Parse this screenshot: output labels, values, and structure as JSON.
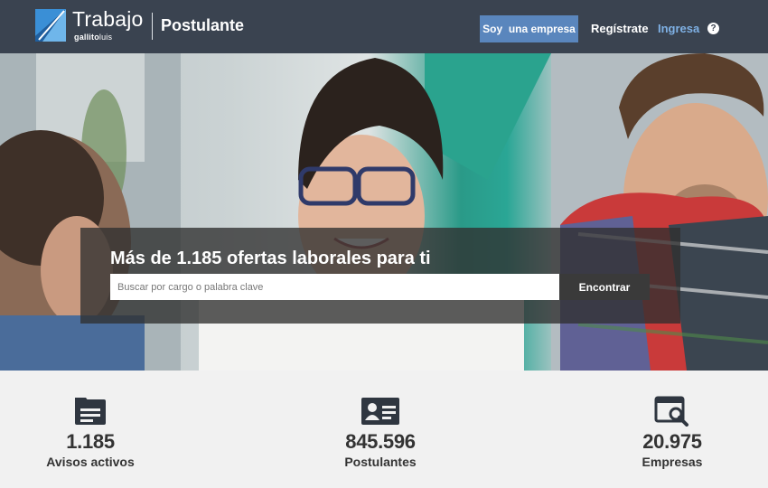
{
  "header": {
    "brand": "Trabajo",
    "sub_brand_bold": "gallito",
    "sub_brand_light": "luis",
    "section": "Postulante",
    "empresa_button": "Soy  una empresa",
    "register_link": "Regístrate",
    "login_link": "Ingresa",
    "help_icon": "?"
  },
  "hero": {
    "title": "Más de 1.185 ofertas laborales para ti",
    "search_placeholder": "Buscar por cargo o palabra clave",
    "search_button": "Encontrar"
  },
  "stats": [
    {
      "icon": "folder-icon",
      "value": "1.185",
      "label": "Avisos activos"
    },
    {
      "icon": "id-card-icon",
      "value": "845.596",
      "label": "Postulantes"
    },
    {
      "icon": "browser-search-icon",
      "value": "20.975",
      "label": "Empresas"
    }
  ],
  "colors": {
    "header_bg": "#3a4350",
    "accent_button": "#5a86bd",
    "login_link": "#7fb1e5",
    "stats_bg": "#f1f1f1"
  }
}
